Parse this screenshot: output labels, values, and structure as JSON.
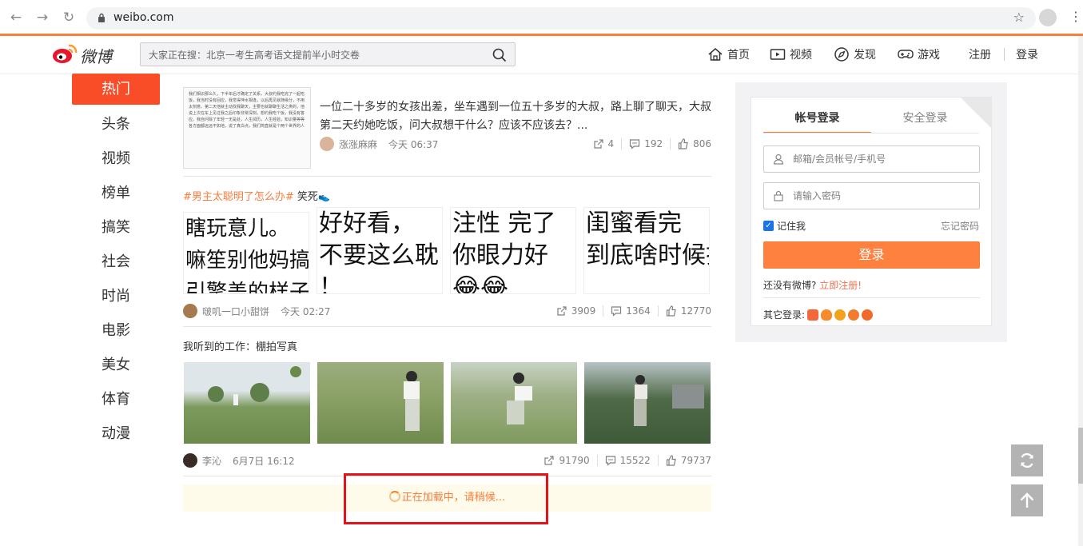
{
  "browser": {
    "url": "weibo.com"
  },
  "header": {
    "logo_text": "微博",
    "search_placeholder": "大家正在搜：北京一考生高考语文提前半小时交卷",
    "nav": [
      {
        "label": "首页",
        "icon": "home-icon"
      },
      {
        "label": "视频",
        "icon": "video-icon"
      },
      {
        "label": "发现",
        "icon": "compass-icon"
      },
      {
        "label": "游戏",
        "icon": "gamepad-icon"
      }
    ],
    "register": "注册",
    "login": "登录"
  },
  "leftnav": {
    "items": [
      "热门",
      "头条",
      "视频",
      "榜单",
      "搞笑",
      "社会",
      "时尚",
      "电影",
      "美女",
      "体育",
      "动漫"
    ],
    "active": 0
  },
  "feed": [
    {
      "thumb_text": "我们相识那么久，下半年后才确定了关系，大叔约我吃完了一起吃饭，我当时没有回应，我觉得萍水相逢，以后再见就随缘分，不用太刻意。第二天他就主动找我聊天，主要也就聊聊生活之类的，他说上次在车上见过我之后印象非常深刻，想约我吃个饭，我没有答应。我自问除了年轻一无是处，人生阅历，人生经验，知识量等等各方面都远远不如他，说了真白点，我们简直就是个两个世界的人",
      "title": "一位二十多岁的女孩出差，坐车遇到一位五十多岁的大叔，路上聊了聊天，大叔第二天约她吃饭，问大叔想干什么？应该不应该去？...",
      "author": "涨涨麻麻",
      "time": "今天 06:37",
      "reposts": "4",
      "comments": "192",
      "likes": "806"
    },
    {
      "hashtag": "#男主太聪明了怎么办#",
      "text": " 笑死",
      "memes": [
        [
          "瞎玩意儿。",
          "嘛笙别他妈搞事业",
          "引擎盖的样子就像"
        ],
        [
          "好好看，",
          "不要这么耽",
          "！"
        ],
        [
          "注性 完了 ",
          "你眼力好",
          "😂😂"
        ],
        [
          "闺蜜看完",
          "到底啥时候打",
          ""
        ]
      ],
      "author": "啵叽一口小甜饼",
      "time": "今天 02:27",
      "reposts": "3909",
      "comments": "1364",
      "likes": "12770"
    },
    {
      "caption": "我听到的工作：棚拍写真",
      "author": "李沁",
      "time": "6月7日 16:12",
      "reposts": "91790",
      "comments": "15522",
      "likes": "79737"
    }
  ],
  "loading_text": "正在加载中，请稍候...",
  "login": {
    "tab_account": "帐号登录",
    "tab_secure": "安全登录",
    "username_placeholder": "邮箱/会员帐号/手机号",
    "password_placeholder": "请输入密码",
    "remember": "记住我",
    "forgot": "忘记密码",
    "button": "登录",
    "no_account": "还没有微博?",
    "register_now": "立即注册!",
    "other_login": "其它登录:"
  }
}
